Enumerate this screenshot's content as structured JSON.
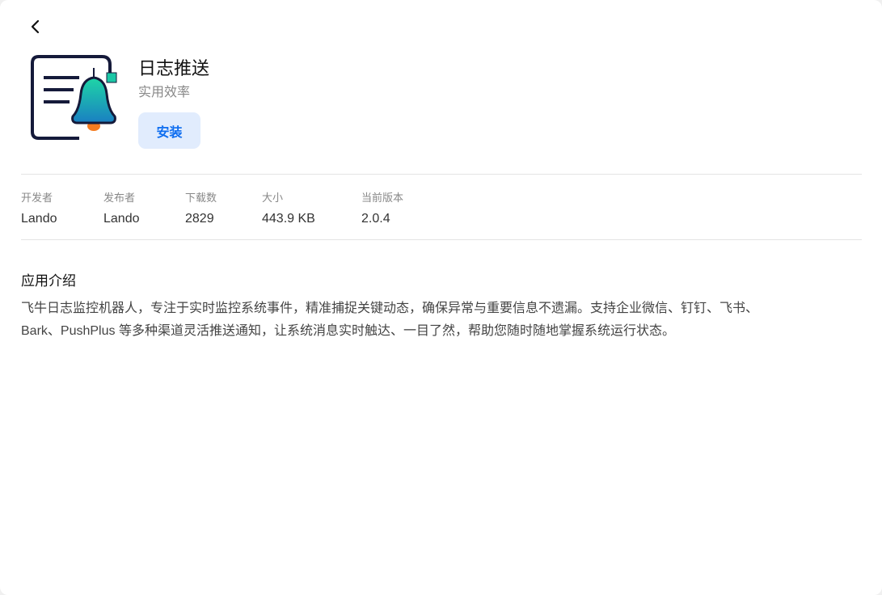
{
  "app": {
    "name": "日志推送",
    "category": "实用效率",
    "install_label": "安装"
  },
  "meta": [
    {
      "label": "开发者",
      "value": "Lando"
    },
    {
      "label": "发布者",
      "value": "Lando"
    },
    {
      "label": "下载数",
      "value": "2829"
    },
    {
      "label": "大小",
      "value": "443.9 KB"
    },
    {
      "label": "当前版本",
      "value": "2.0.4"
    }
  ],
  "intro": {
    "heading": "应用介绍",
    "line1": "飞牛日志监控机器人，专注于实时监控系统事件，精准捕捉关键动态，确保异常与重要信息不遗漏。支持企业微信、钉钉、飞书、",
    "line2": "Bark、PushPlus 等多种渠道灵活推送通知，让系统消息实时触达、一目了然，帮助您随时随地掌握系统运行状态。"
  },
  "colors": {
    "accent": "#0f6ef0",
    "button_bg": "#e1ecfd"
  }
}
